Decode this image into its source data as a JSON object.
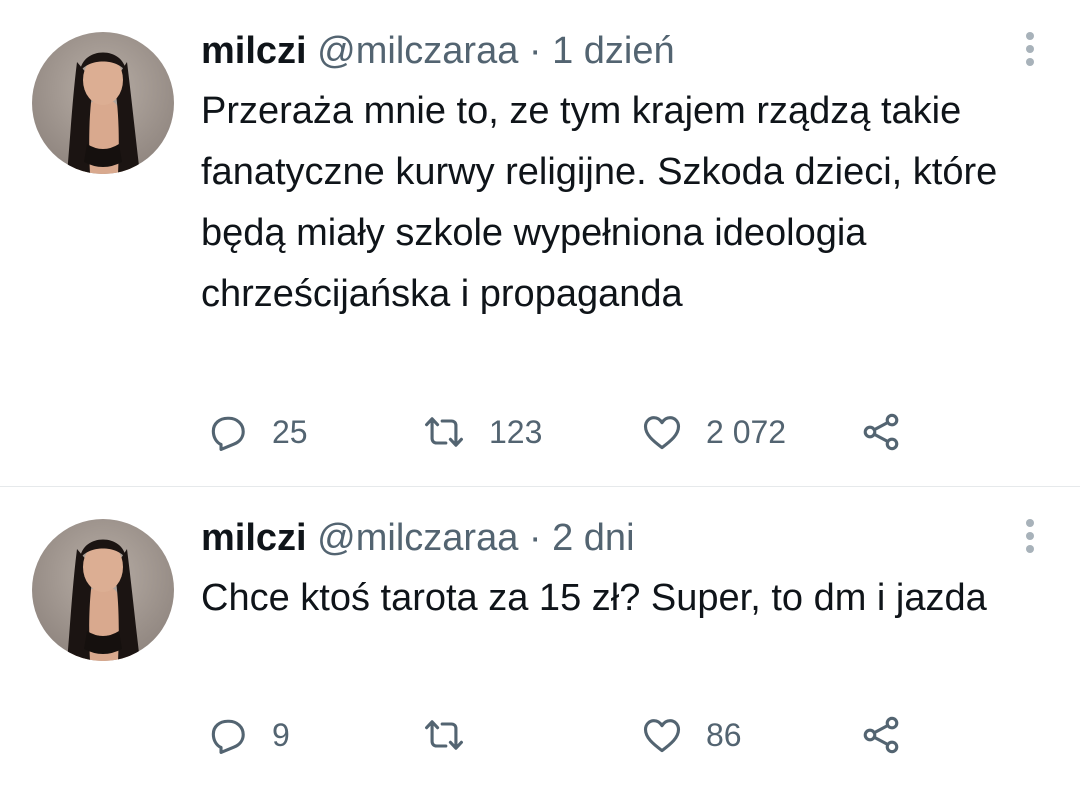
{
  "tweets": [
    {
      "display_name": "milczi",
      "meta": "@milczaraa · 1 dzień",
      "text": "Przeraża mnie to, ze tym krajem rządzą takie fanatyczne kurwy religijne. Szkoda dzieci, które będą miały szkole wypełniona ideologia chrześcijańska i propaganda",
      "replies": "25",
      "retweets": "123",
      "likes": "2 072"
    },
    {
      "display_name": "milczi",
      "meta": "@milczaraa · 2 dni",
      "text": "Chce ktoś tarota za 15 zł? Super, to dm i jazda",
      "replies": "9",
      "retweets": "",
      "likes": "86"
    }
  ],
  "icons": {
    "reply": "reply-icon",
    "retweet": "retweet-icon",
    "like": "heart-icon",
    "share": "share-icon",
    "more": "more-vertical-icon"
  },
  "colors": {
    "text": "#0f1419",
    "secondary": "#536471",
    "icon": "#536471",
    "divider": "#e6e9eb"
  }
}
